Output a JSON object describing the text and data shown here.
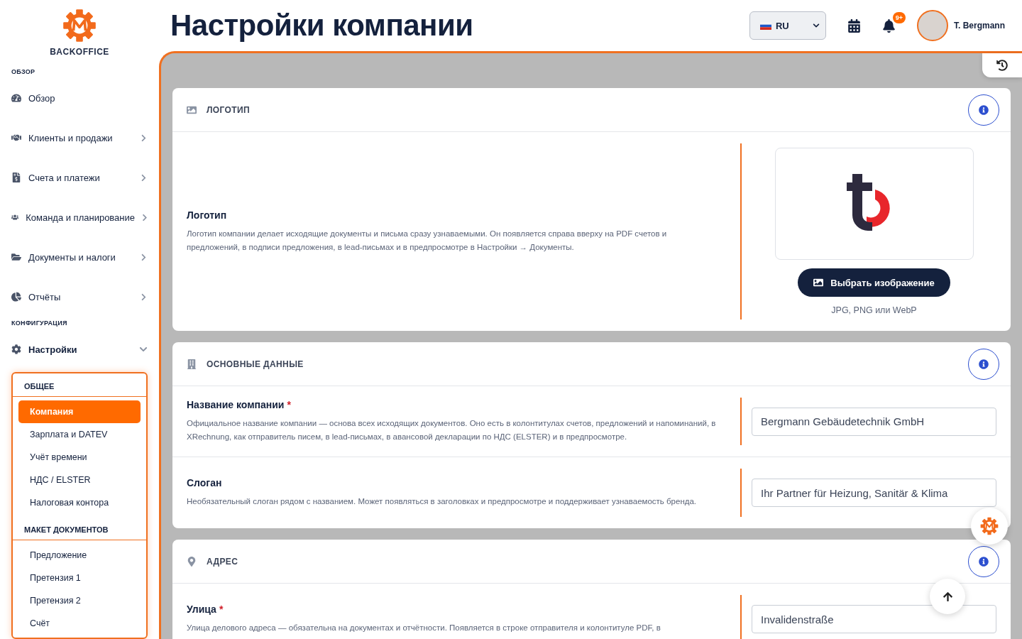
{
  "brand": {
    "name": "BACKOFFICE"
  },
  "sidebar": {
    "sections": [
      {
        "title": "ОБЗОР",
        "items": [
          {
            "label": "Обзор",
            "kind": "link",
            "selected": false
          },
          {
            "label": "Клиенты и продажи",
            "kind": "group",
            "expanded": false,
            "selected": false
          },
          {
            "label": "Счета и платежи",
            "kind": "group",
            "expanded": false,
            "selected": false
          },
          {
            "label": "Команда и планирование",
            "kind": "group",
            "expanded": false,
            "selected": false
          },
          {
            "label": "Документы и налоги",
            "kind": "group",
            "expanded": false,
            "selected": false
          },
          {
            "label": "Отчёты",
            "kind": "group",
            "expanded": false,
            "selected": false
          }
        ]
      },
      {
        "title": "КОНФИГУРАЦИЯ",
        "items": [
          {
            "label": "Настройки",
            "kind": "group",
            "expanded": true,
            "selected": true
          }
        ]
      }
    ],
    "submenu": [
      {
        "title": "ОБЩЕЕ",
        "items": [
          {
            "label": "Компания",
            "selected": true
          },
          {
            "label": "Зарплата и DATEV",
            "selected": false
          },
          {
            "label": "Учёт времени",
            "selected": false
          },
          {
            "label": "НДС / ELSTER",
            "selected": false
          },
          {
            "label": "Налоговая контора",
            "selected": false
          }
        ]
      },
      {
        "title": "МАКЕТ ДОКУМЕНТОВ",
        "items": [
          {
            "label": "Предложение",
            "selected": false
          },
          {
            "label": "Претензия 1",
            "selected": false
          },
          {
            "label": "Претензия 2",
            "selected": false
          },
          {
            "label": "Счёт",
            "selected": false
          }
        ]
      }
    ]
  },
  "header": {
    "title": "Настройки компании",
    "language": "RU",
    "notifications_badge": "9+",
    "user_name": "T. Bergmann"
  },
  "sections": [
    {
      "kind": "logo",
      "title": "ЛОГОТИП",
      "label": "Логотип",
      "description": "Логотип компании делает исходящие документы и письма сразу узнаваемыми. Он появляется справа вверху на PDF счетов и предложений, в подписи предложения, в lead-письмах и в предпросмотре в Настройки → Документы.",
      "button": "Выбрать изображение",
      "hint": "JPG, PNG или WebP"
    },
    {
      "kind": "fields",
      "title": "ОСНОВНЫЕ ДАННЫЕ",
      "fields": [
        {
          "label": "Название компании",
          "required_mark": "*",
          "description": "Официальное название компании — основа всех исходящих документов. Оно есть в колонтитулах счетов, предложений и напоминаний, в XRechnung, как отправитель писем, в lead-письмах, в авансовой декларации по НДС (ELSTER) и в предпросмотре.",
          "value": "Bergmann Gebäudetechnik GmbH"
        },
        {
          "label": "Слоган",
          "description": "Необязательный слоган рядом с названием. Может появляться в заголовках и предпросмотре и поддерживает узнаваемость бренда.",
          "value": "Ihr Partner für Heizung, Sanitär & Klima"
        }
      ]
    },
    {
      "kind": "fields",
      "title": "АДРЕС",
      "fields": [
        {
          "label": "Улица",
          "required_mark": "*",
          "description": "Улица делового адреса — обязательна на документах и отчётности. Появляется в строке отправителя и колонтитуле PDF, в",
          "value": "Invalidenstraße"
        }
      ]
    }
  ]
}
